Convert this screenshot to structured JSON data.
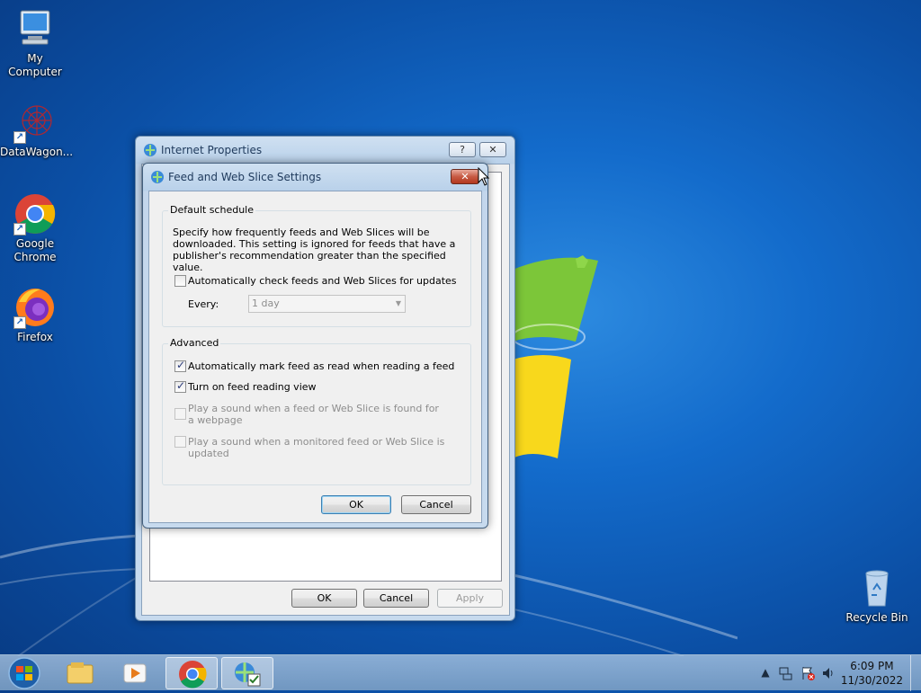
{
  "desktop": {
    "icons": [
      {
        "label": "My Computer",
        "icon": "computer-icon"
      },
      {
        "label": "DataWagon...",
        "icon": "datawagon-icon"
      },
      {
        "label": "Google Chrome",
        "icon": "chrome-icon"
      },
      {
        "label": "Firefox",
        "icon": "firefox-icon"
      },
      {
        "label": "Recycle Bin",
        "icon": "recycle-bin-icon"
      }
    ]
  },
  "internet_properties": {
    "title": "Internet Properties",
    "help_label": "?",
    "close_label": "✕",
    "ok_label": "OK",
    "cancel_label": "Cancel",
    "apply_label": "Apply"
  },
  "feed_dialog": {
    "title": "Feed and Web Slice Settings",
    "close_label": "✕",
    "default_schedule": {
      "label": "Default schedule",
      "description": "Specify how frequently feeds and Web Slices will be downloaded. This setting is ignored for feeds that have a publisher's recommendation greater than the specified value.",
      "auto_check_label": "Automatically check feeds and Web Slices for updates",
      "auto_check_checked": false,
      "every_label": "Every:",
      "every_value": "1 day"
    },
    "advanced": {
      "label": "Advanced",
      "options": [
        {
          "label": "Automatically mark feed as read when reading a feed",
          "checked": true,
          "enabled": true
        },
        {
          "label": "Turn on feed reading view",
          "checked": true,
          "enabled": true
        },
        {
          "label": "Play a sound when a feed or Web Slice is found for a webpage",
          "checked": false,
          "enabled": false
        },
        {
          "label": "Play a sound when a monitored feed or Web Slice is updated",
          "checked": false,
          "enabled": false
        }
      ]
    },
    "ok_label": "OK",
    "cancel_label": "Cancel"
  },
  "taskbar": {
    "pinned": [
      "windows-explorer-icon",
      "media-player-icon",
      "chrome-icon",
      "internet-options-icon"
    ],
    "clock": {
      "time": "6:09 PM",
      "date": "11/30/2022"
    }
  },
  "colors": {
    "desktop_blue": "#136bcb",
    "dialog_bg": "#f0f0f0",
    "close_red": "#c75a44"
  }
}
